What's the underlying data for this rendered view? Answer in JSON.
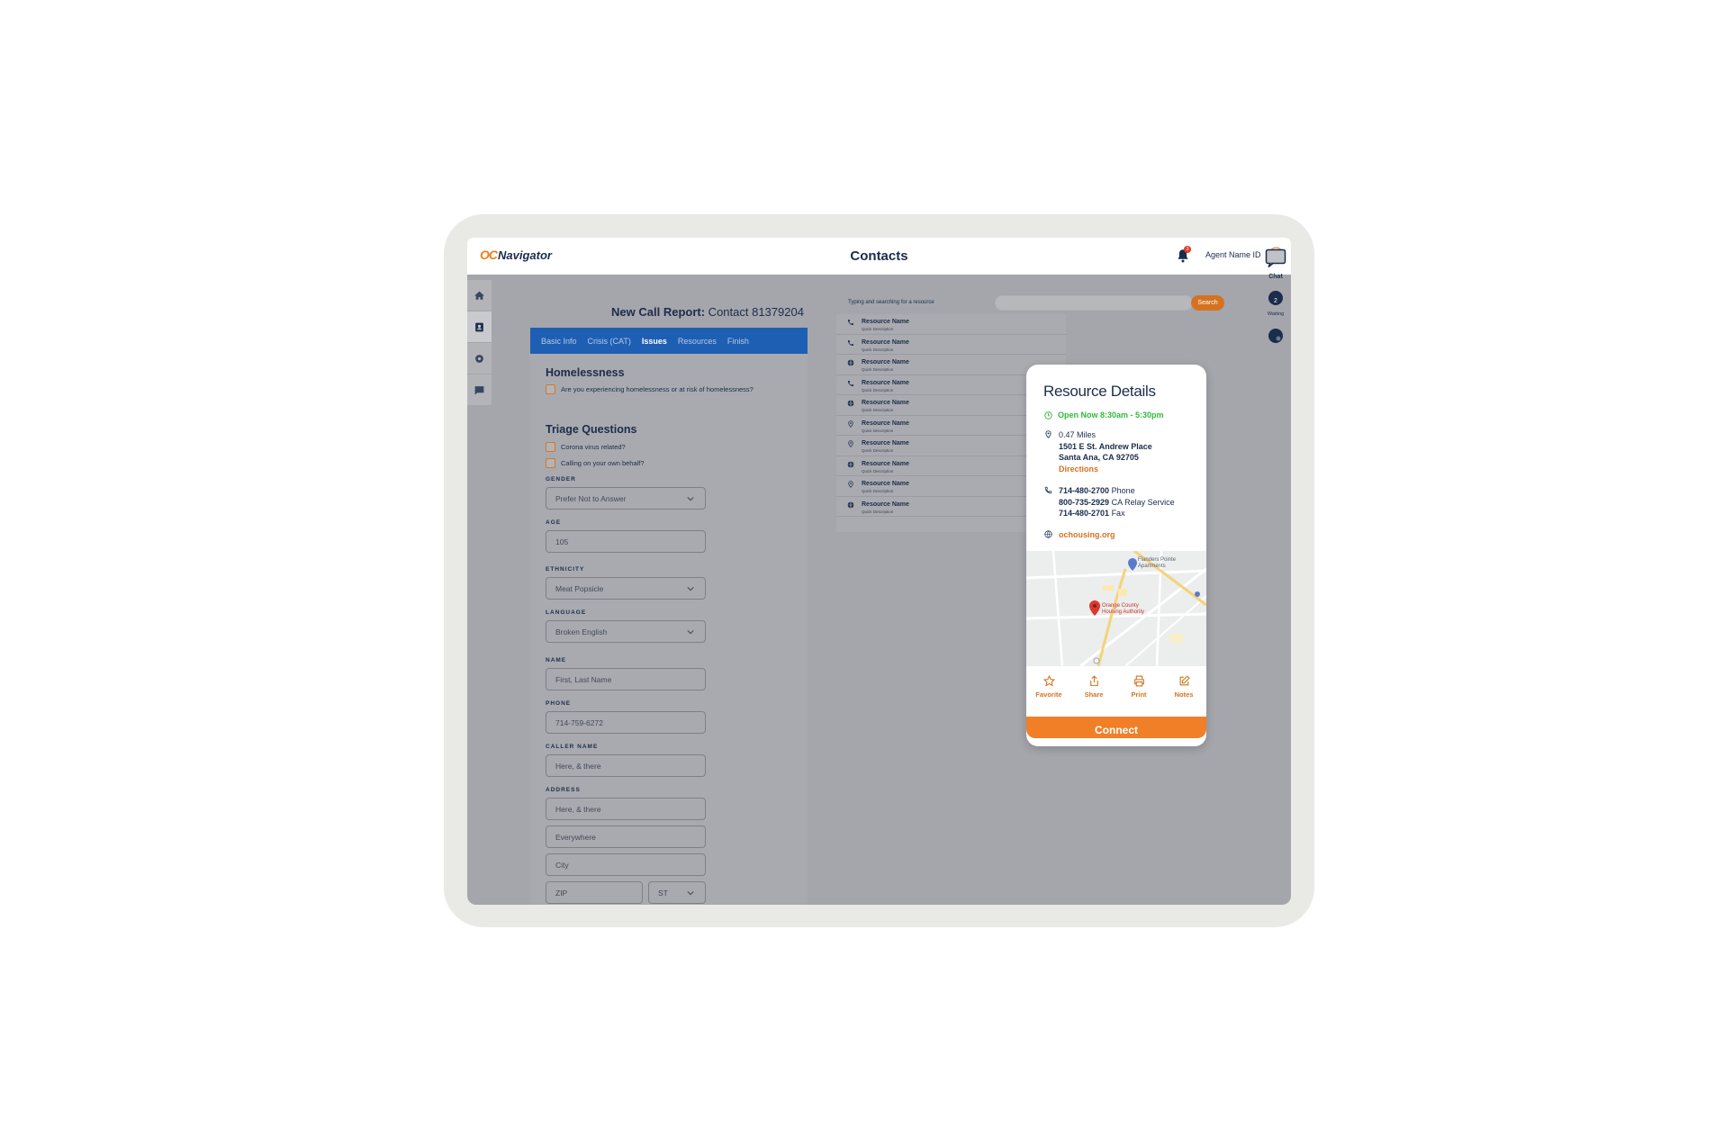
{
  "app": {
    "logo_prefix": "OC",
    "logo_name": "Navigator",
    "page_title": "Contacts",
    "notification_count": "3",
    "agent_label": "Agent Name ID"
  },
  "report": {
    "title_bold": "New Call Report:",
    "title_rest": " Contact 81379204",
    "tabs": [
      "Basic Info",
      "Crisis (CAT)",
      "Issues",
      "Resources",
      "Finish"
    ],
    "active_tab": "Issues",
    "homelessness": {
      "title": "Homelessness",
      "question": "Are you experiencing homelessness or at risk of homelessness?"
    },
    "triage": {
      "title": "Triage Questions",
      "q1": "Corona virus related?",
      "q2": "Calling on your own behalf?"
    },
    "fields": {
      "gender_label": "GENDER",
      "gender_value": "Prefer Not to Answer",
      "age_label": "AGE",
      "age_value": "105",
      "ethnicity_label": "ETHNICITY",
      "ethnicity_value": "Meat Popsicle",
      "language_label": "LANGUAGE",
      "language_value": "Broken English",
      "name_label": "NAME",
      "name_value": "First, Last Name",
      "phone_label": "PHONE",
      "phone_value": "714-759-6272",
      "caller_label": "CALLER NAME",
      "caller_value": "Here, & there",
      "address_label": "ADDRESS",
      "address1": "Here, & there",
      "address2": "Everywhere",
      "city": "City",
      "zip": "ZIP",
      "state": "ST"
    }
  },
  "search": {
    "label": "Typing and searching for a resource",
    "button": "Search"
  },
  "results": [
    {
      "name": "Resource Name",
      "desc": "Quick Description",
      "icon": "phone-icon"
    },
    {
      "name": "Resource Name",
      "desc": "Quick Description",
      "icon": "phone-icon"
    },
    {
      "name": "Resource Name",
      "desc": "Quick Description",
      "icon": "globe-icon"
    },
    {
      "name": "Resource Name",
      "desc": "Quick Description",
      "icon": "phone-icon"
    },
    {
      "name": "Resource Name",
      "desc": "Quick Description",
      "icon": "globe-icon"
    },
    {
      "name": "Resource Name",
      "desc": "Quick Description",
      "icon": "pin-icon"
    },
    {
      "name": "Resource Name",
      "desc": "Quick Description",
      "icon": "pin-icon"
    },
    {
      "name": "Resource Name",
      "desc": "Quick Description",
      "icon": "globe-icon"
    },
    {
      "name": "Resource Name",
      "desc": "Quick Description",
      "icon": "pin-icon"
    },
    {
      "name": "Resource Name",
      "desc": "Quick Description",
      "icon": "globe-icon"
    }
  ],
  "rail": {
    "chat_label": "Chat",
    "waiting_label": "Waiting"
  },
  "details": {
    "title": "Resource Details",
    "open_now": "Open Now 8:30am - 5:30pm",
    "distance": "0.47 Miles",
    "street": "1501 E St. Andrew Place",
    "city_line": "Santa Ana, CA 92705",
    "directions": "Directions",
    "phone1": "714-480-2700",
    "phone1_type": " Phone",
    "phone2": "800-735-2929",
    "phone2_type": " CA Relay Service",
    "phone3": "714-480-2701",
    "phone3_type": " Fax",
    "website": "ochousing.org",
    "map_label1": "Flanders Pointe Apartments",
    "map_label2": "Orange County Housing Authority",
    "actions": {
      "favorite": "Favorite",
      "share": "Share",
      "print": "Print",
      "notes": "Notes"
    },
    "connect": "Connect"
  },
  "colors": {
    "brand_navy": "#1b2c4c",
    "accent_orange": "#f07f28",
    "tab_blue": "#1e5fb4",
    "open_green": "#2fbb3a"
  }
}
